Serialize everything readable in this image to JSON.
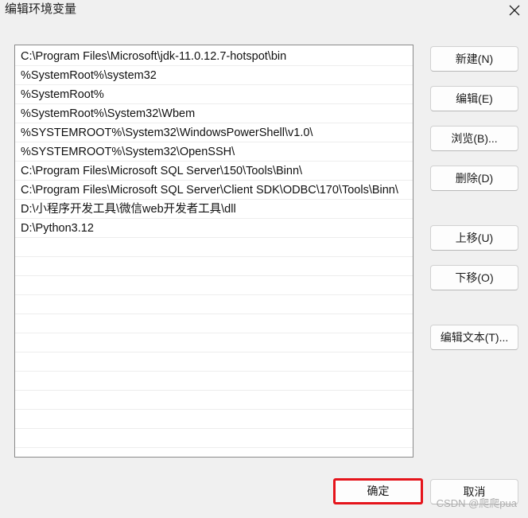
{
  "window": {
    "title": "编辑环境变量",
    "close_icon": "close-icon"
  },
  "path_list": {
    "items": [
      "C:\\Program Files\\Microsoft\\jdk-11.0.12.7-hotspot\\bin",
      "%SystemRoot%\\system32",
      "%SystemRoot%",
      "%SystemRoot%\\System32\\Wbem",
      "%SYSTEMROOT%\\System32\\WindowsPowerShell\\v1.0\\",
      "%SYSTEMROOT%\\System32\\OpenSSH\\",
      "C:\\Program Files\\Microsoft SQL Server\\150\\Tools\\Binn\\",
      "C:\\Program Files\\Microsoft SQL Server\\Client SDK\\ODBC\\170\\Tools\\Binn\\",
      "D:\\小程序开发工具\\微信web开发者工具\\dll",
      "D:\\Python3.12",
      "",
      "",
      "",
      "",
      "",
      "",
      "",
      "",
      "",
      "",
      "",
      ""
    ]
  },
  "buttons": {
    "new": "新建(N)",
    "edit": "编辑(E)",
    "browse": "浏览(B)...",
    "delete": "删除(D)",
    "move_up": "上移(U)",
    "move_down": "下移(O)",
    "edit_text": "编辑文本(T)...",
    "ok": "确定",
    "cancel": "取消"
  },
  "watermark": "CSDN @爬爬pua",
  "colors": {
    "highlight_border": "#e5141b",
    "window_bg": "#f0f0f0"
  }
}
